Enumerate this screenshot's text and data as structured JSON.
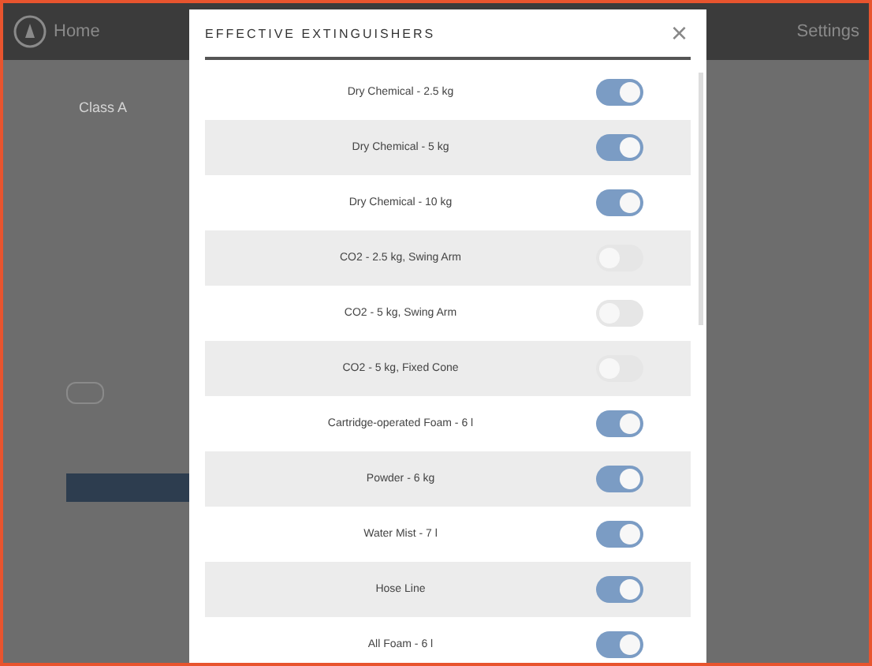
{
  "header": {
    "breadcrumb": "Home",
    "settings": "Settings"
  },
  "background_form": {
    "class_value": "Class A",
    "toggle_on": false
  },
  "modal": {
    "title": "EFFECTIVE EXTINGUISHERS",
    "close": "×",
    "items": [
      {
        "label": "Dry Chemical - 2.5 kg",
        "on": true
      },
      {
        "label": "Dry Chemical - 5 kg",
        "on": true
      },
      {
        "label": "Dry Chemical - 10 kg",
        "on": true
      },
      {
        "label": "CO2 - 2.5 kg, Swing Arm",
        "on": false
      },
      {
        "label": "CO2 - 5 kg, Swing Arm",
        "on": false
      },
      {
        "label": "CO2 - 5 kg, Fixed Cone",
        "on": false
      },
      {
        "label": "Cartridge-operated Foam - 6 l",
        "on": true
      },
      {
        "label": "Powder - 6 kg",
        "on": true
      },
      {
        "label": "Water Mist - 7 l",
        "on": true
      },
      {
        "label": "Hose Line",
        "on": true
      },
      {
        "label": "All Foam - 6 l",
        "on": true
      }
    ]
  }
}
